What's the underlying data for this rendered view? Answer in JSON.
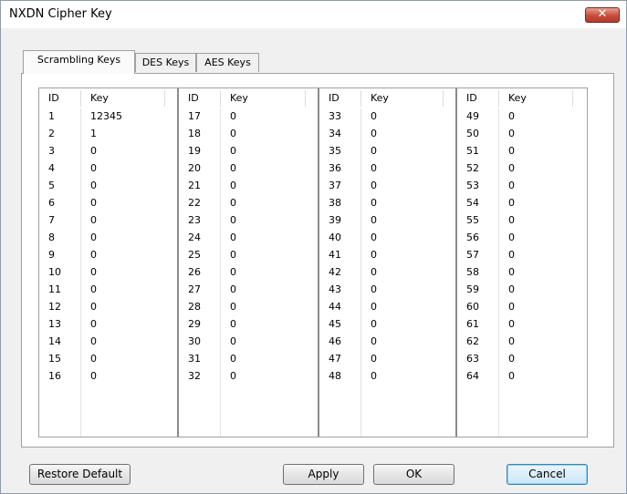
{
  "window": {
    "title": "NXDN Cipher Key",
    "close_glyph": "✕"
  },
  "tabs": [
    {
      "label": "Scrambling Keys",
      "active": true
    },
    {
      "label": "DES Keys",
      "active": false
    },
    {
      "label": "AES Keys",
      "active": false
    }
  ],
  "table": {
    "id_header": "ID",
    "key_header": "Key",
    "columns": [
      {
        "rows": [
          [
            "1",
            "12345"
          ],
          [
            "2",
            "1"
          ],
          [
            "3",
            "0"
          ],
          [
            "4",
            "0"
          ],
          [
            "5",
            "0"
          ],
          [
            "6",
            "0"
          ],
          [
            "7",
            "0"
          ],
          [
            "8",
            "0"
          ],
          [
            "9",
            "0"
          ],
          [
            "10",
            "0"
          ],
          [
            "11",
            "0"
          ],
          [
            "12",
            "0"
          ],
          [
            "13",
            "0"
          ],
          [
            "14",
            "0"
          ],
          [
            "15",
            "0"
          ],
          [
            "16",
            "0"
          ]
        ]
      },
      {
        "rows": [
          [
            "17",
            "0"
          ],
          [
            "18",
            "0"
          ],
          [
            "19",
            "0"
          ],
          [
            "20",
            "0"
          ],
          [
            "21",
            "0"
          ],
          [
            "22",
            "0"
          ],
          [
            "23",
            "0"
          ],
          [
            "24",
            "0"
          ],
          [
            "25",
            "0"
          ],
          [
            "26",
            "0"
          ],
          [
            "27",
            "0"
          ],
          [
            "28",
            "0"
          ],
          [
            "29",
            "0"
          ],
          [
            "30",
            "0"
          ],
          [
            "31",
            "0"
          ],
          [
            "32",
            "0"
          ]
        ]
      },
      {
        "rows": [
          [
            "33",
            "0"
          ],
          [
            "34",
            "0"
          ],
          [
            "35",
            "0"
          ],
          [
            "36",
            "0"
          ],
          [
            "37",
            "0"
          ],
          [
            "38",
            "0"
          ],
          [
            "39",
            "0"
          ],
          [
            "40",
            "0"
          ],
          [
            "41",
            "0"
          ],
          [
            "42",
            "0"
          ],
          [
            "43",
            "0"
          ],
          [
            "44",
            "0"
          ],
          [
            "45",
            "0"
          ],
          [
            "46",
            "0"
          ],
          [
            "47",
            "0"
          ],
          [
            "48",
            "0"
          ]
        ]
      },
      {
        "rows": [
          [
            "49",
            "0"
          ],
          [
            "50",
            "0"
          ],
          [
            "51",
            "0"
          ],
          [
            "52",
            "0"
          ],
          [
            "53",
            "0"
          ],
          [
            "54",
            "0"
          ],
          [
            "55",
            "0"
          ],
          [
            "56",
            "0"
          ],
          [
            "57",
            "0"
          ],
          [
            "58",
            "0"
          ],
          [
            "59",
            "0"
          ],
          [
            "60",
            "0"
          ],
          [
            "61",
            "0"
          ],
          [
            "62",
            "0"
          ],
          [
            "63",
            "0"
          ],
          [
            "64",
            "0"
          ]
        ]
      }
    ]
  },
  "buttons": {
    "restore_default": "Restore Default",
    "apply": "Apply",
    "ok": "OK",
    "cancel": "Cancel"
  },
  "colors": {
    "close_button": "#c74c3a",
    "default_button_border": "#3c7fb1"
  }
}
